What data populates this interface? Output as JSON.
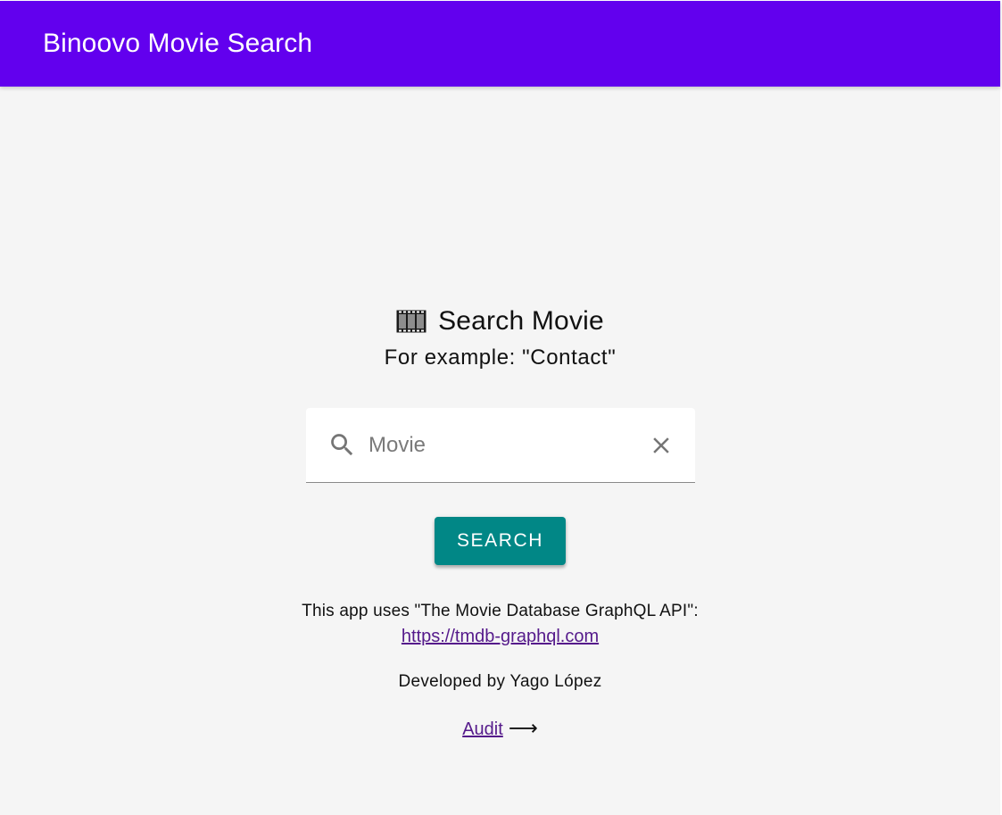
{
  "header": {
    "title": "Binoovo Movie Search"
  },
  "search_section": {
    "heading": "Search Movie",
    "hint": "For example: \"Contact\"",
    "input": {
      "value": "",
      "placeholder": "Movie"
    },
    "button_label": "SEARCH"
  },
  "footer": {
    "info": "This app uses \"The Movie Database GraphQL API\":",
    "api_link": "https://tmdb-graphql.com",
    "developer": "Developed by Yago López",
    "audit_link": "Audit",
    "audit_arrow": "⟶"
  },
  "icons": {
    "heading_icon": "film-frames-icon",
    "search_icon": "search-icon",
    "clear_icon": "close-icon"
  },
  "colors": {
    "header_bg": "#6200ee",
    "button_bg": "#018786",
    "link": "#551a8b",
    "page_bg": "#f5f5f5"
  }
}
